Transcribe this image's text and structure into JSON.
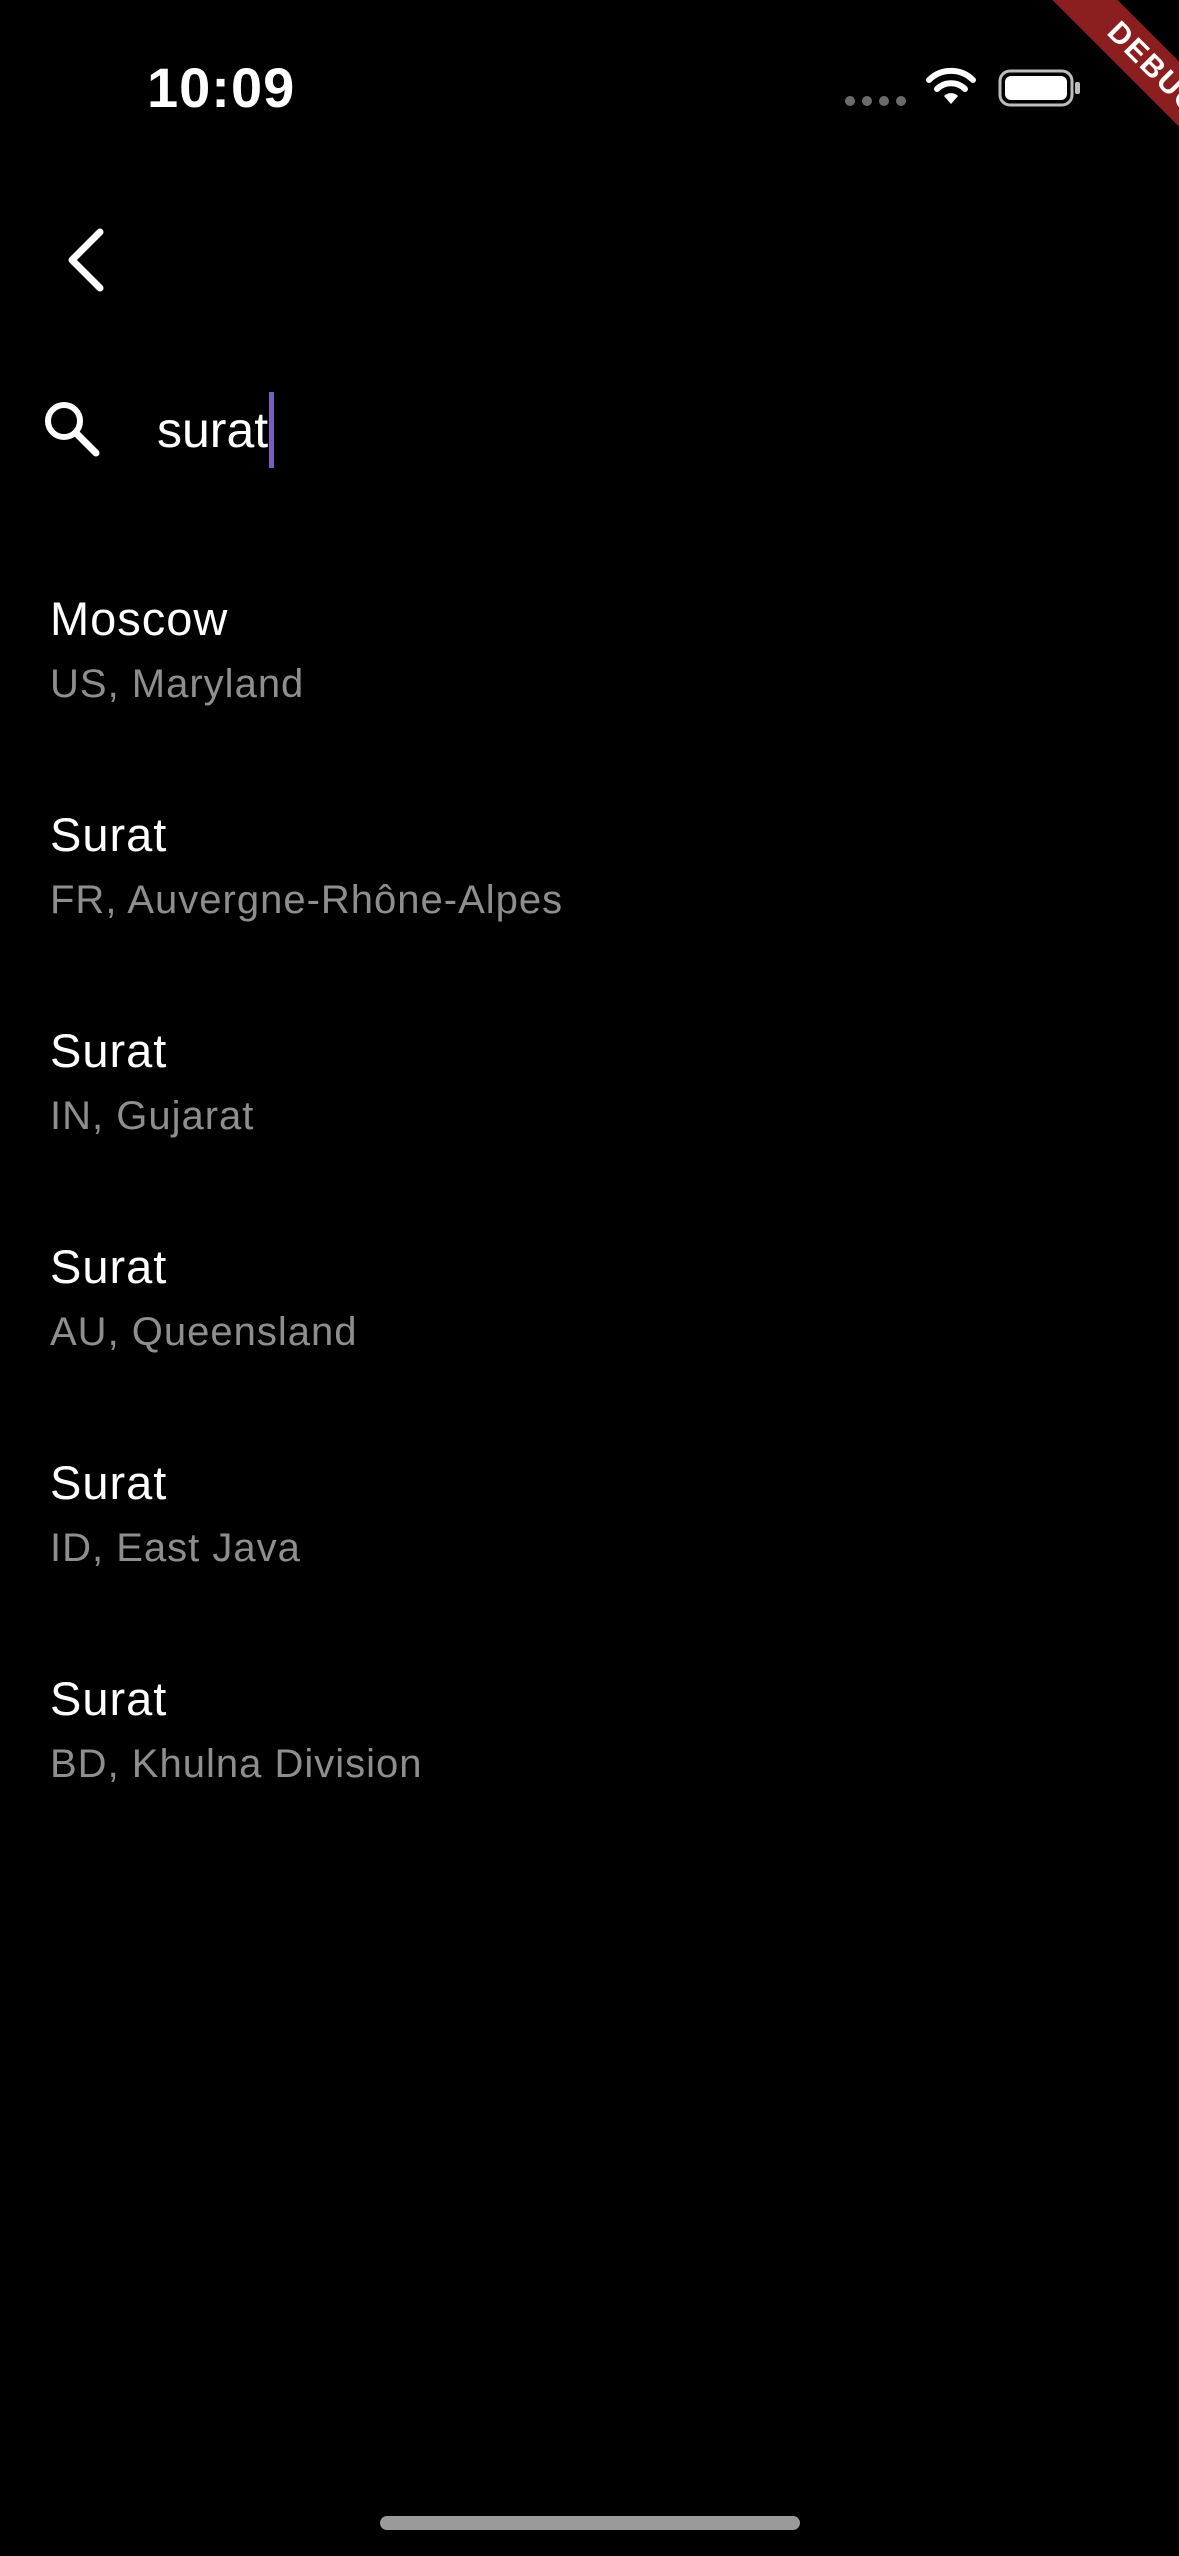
{
  "status_bar": {
    "time": "10:09"
  },
  "debug_banner": {
    "label": "DEBUG",
    "color": "#8b1e1e"
  },
  "navigation": {
    "back_icon": "chevron-left-icon"
  },
  "search": {
    "icon": "search-icon",
    "value": "surat",
    "caret_color": "#7a5cc0"
  },
  "results": [
    {
      "city": "Moscow",
      "region": "US, Maryland"
    },
    {
      "city": "Surat",
      "region": "FR, Auvergne-Rhône-Alpes"
    },
    {
      "city": "Surat",
      "region": "IN, Gujarat"
    },
    {
      "city": "Surat",
      "region": "AU, Queensland"
    },
    {
      "city": "Surat",
      "region": "ID, East Java"
    },
    {
      "city": "Surat",
      "region": "BD, Khulna Division"
    }
  ]
}
